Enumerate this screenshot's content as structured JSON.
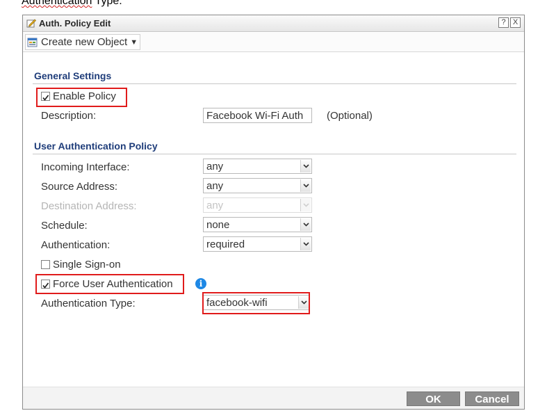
{
  "caption": {
    "squiggle": "Authentication",
    "rest": " Type."
  },
  "dialog": {
    "title": "Auth. Policy Edit",
    "help_label": "?",
    "close_label": "X"
  },
  "toolbar": {
    "create_label": "Create new Object",
    "caret": "▼"
  },
  "general": {
    "title": "General Settings",
    "enable_label": "Enable Policy",
    "enable_checked": true,
    "description_label": "Description:",
    "description_value": "Facebook Wi-Fi Auth",
    "optional_label": "(Optional)"
  },
  "uap": {
    "title": "User Authentication Policy",
    "incoming_label": "Incoming Interface:",
    "incoming_value": "any",
    "source_label": "Source Address:",
    "source_value": "any",
    "destination_label": "Destination Address:",
    "destination_value": "any",
    "schedule_label": "Schedule:",
    "schedule_value": "none",
    "authentication_label": "Authentication:",
    "authentication_value": "required",
    "sso_label": "Single Sign-on",
    "sso_checked": false,
    "force_label": "Force User Authentication",
    "force_checked": true,
    "info_icon": "i",
    "auth_type_label": "Authentication Type:",
    "auth_type_value": "facebook-wifi"
  },
  "footer": {
    "ok_label": "OK",
    "cancel_label": "Cancel"
  },
  "colors": {
    "highlight": "#e01b1b",
    "section_title": "#1f3d7a",
    "button": "#8c8c8c",
    "info": "#1e88e5"
  }
}
